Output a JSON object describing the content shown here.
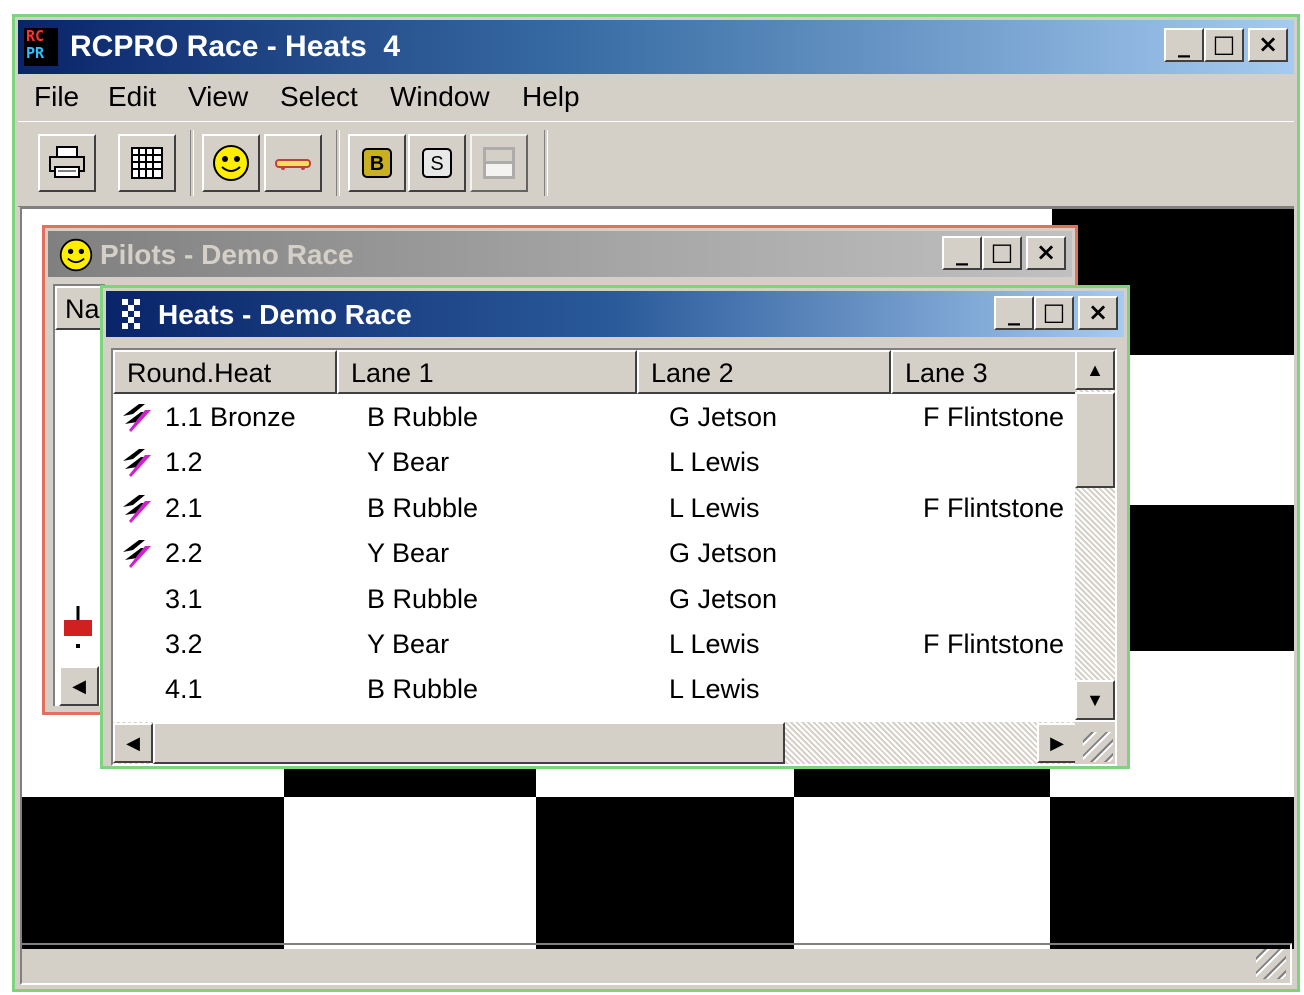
{
  "app": {
    "logo_top": "RC",
    "logo_bottom": "PR",
    "title": "RCPRO Race - Heats  4"
  },
  "menu": {
    "items": [
      "File",
      "Edit",
      "View",
      "Select",
      "Window",
      "Help"
    ]
  },
  "toolbar": {
    "buttons": [
      {
        "icon": "printer-icon"
      },
      {
        "icon": "grid-icon"
      },
      {
        "icon": "smiley-icon"
      },
      {
        "icon": "car-icon"
      },
      {
        "label": "B",
        "icon": "b-box-icon"
      },
      {
        "label": "S",
        "icon": "s-box-icon"
      },
      {
        "icon": "panel-icon"
      }
    ]
  },
  "pilots_window": {
    "title": "Pilots - Demo Race",
    "column_peek": "Na"
  },
  "heats_window": {
    "title": "Heats - Demo Race",
    "columns": [
      "Round.Heat",
      "Lane 1",
      "Lane 2",
      "Lane 3"
    ],
    "rows": [
      {
        "heat": "1.1 Bronze",
        "lane1": "B Rubble",
        "lane2": "G Jetson",
        "lane3": "F Flintstone",
        "flag": true
      },
      {
        "heat": "1.2",
        "lane1": "Y Bear",
        "lane2": "L Lewis",
        "lane3": "",
        "flag": true
      },
      {
        "heat": "2.1",
        "lane1": "B Rubble",
        "lane2": "L Lewis",
        "lane3": "F Flintstone",
        "flag": true
      },
      {
        "heat": "2.2",
        "lane1": "Y Bear",
        "lane2": "G Jetson",
        "lane3": "",
        "flag": true
      },
      {
        "heat": "3.1",
        "lane1": "B Rubble",
        "lane2": "G Jetson",
        "lane3": "",
        "flag": false
      },
      {
        "heat": "3.2",
        "lane1": "Y Bear",
        "lane2": "L Lewis",
        "lane3": "F Flintstone",
        "flag": false
      },
      {
        "heat": "4.1",
        "lane1": "B Rubble",
        "lane2": "L Lewis",
        "lane3": "",
        "flag": false
      }
    ]
  },
  "colors": {
    "active_title": "#0a246a",
    "inactive_title": "#808080",
    "face": "#d4d0c8",
    "flag_accent": "#d020d0"
  }
}
